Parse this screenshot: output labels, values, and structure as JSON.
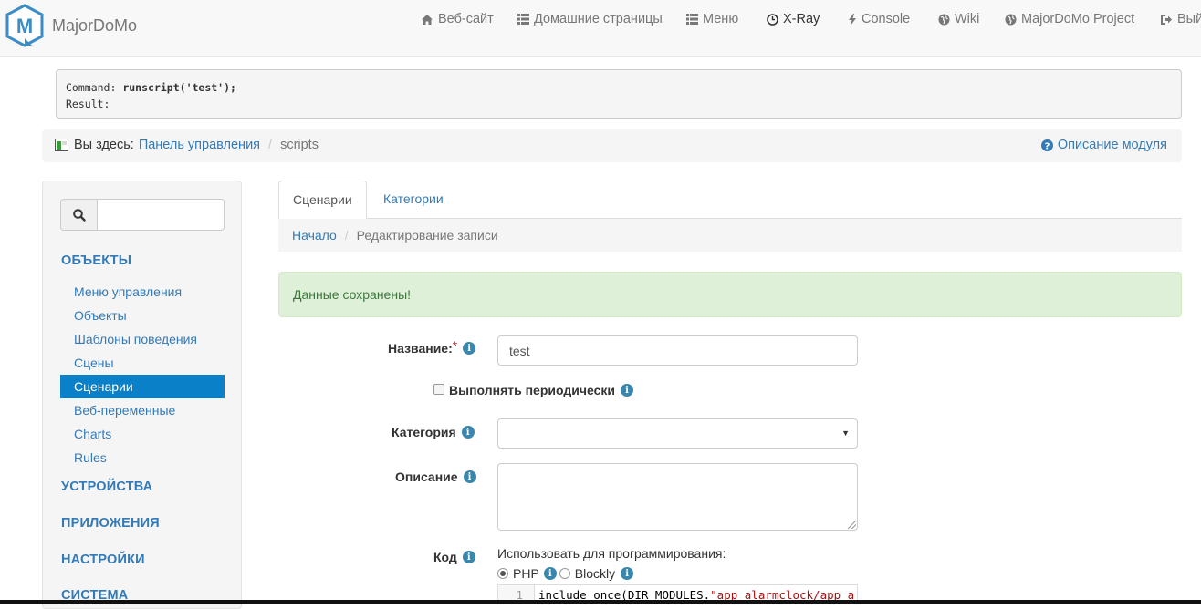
{
  "brand": {
    "name": "MajorDoMo"
  },
  "nav": [
    {
      "label": "Веб-сайт",
      "icon": "home-icon"
    },
    {
      "label": "Домашние страницы",
      "icon": "grid-icon"
    },
    {
      "label": "Меню",
      "icon": "list-icon"
    },
    {
      "label": "X-Ray",
      "icon": "clock-icon",
      "active": true
    },
    {
      "label": "Console",
      "icon": "flash-icon"
    },
    {
      "label": "Wiki",
      "icon": "globe-icon"
    },
    {
      "label": "MajorDoMo Project",
      "icon": "globe-icon"
    },
    {
      "label": "Вый",
      "icon": "logout-icon"
    }
  ],
  "command": {
    "label": "Command:",
    "value": "runscript('test');",
    "result_label": "Result:"
  },
  "breadcrumb": {
    "prefix": "Вы здесь:",
    "home": "Панель управления",
    "current": "scripts",
    "help": "Описание модуля"
  },
  "sidebar": {
    "search_value": "",
    "sections": {
      "objects": "ОБЪЕКТЫ",
      "devices": "УСТРОЙСТВА",
      "apps": "ПРИЛОЖЕНИЯ",
      "settings": "НАСТРОЙКИ",
      "system": "СИСТЕМА"
    },
    "items": [
      "Меню управления",
      "Объекты",
      "Шаблоны поведения",
      "Сцены",
      "Сценарии",
      "Веб-переменные",
      "Charts",
      "Rules"
    ],
    "active_item": "Сценарии"
  },
  "tabs": [
    "Сценарии",
    "Категории"
  ],
  "subcrumb": {
    "home": "Начало",
    "current": "Редактирование записи"
  },
  "alert": "Данные сохранены!",
  "form": {
    "name_label": "Название:",
    "name_value": "test",
    "periodic_label": "Выполнять периодически",
    "category_label": "Категория",
    "category_value": "",
    "description_label": "Описание",
    "description_value": "",
    "code_label": "Код",
    "lang_prompt": "Использовать для программирования:",
    "lang_php": "PHP",
    "lang_blockly": "Blockly",
    "code_line_no": "1",
    "code_fn": "include_once(DIR_MODULES.",
    "code_str": "\"app_alarmclock/app_a"
  },
  "colors": {
    "accent": "#337ab7",
    "active_bg": "#0a80c9",
    "alert_bg": "#dff0d8",
    "alert_text": "#3c763d"
  }
}
